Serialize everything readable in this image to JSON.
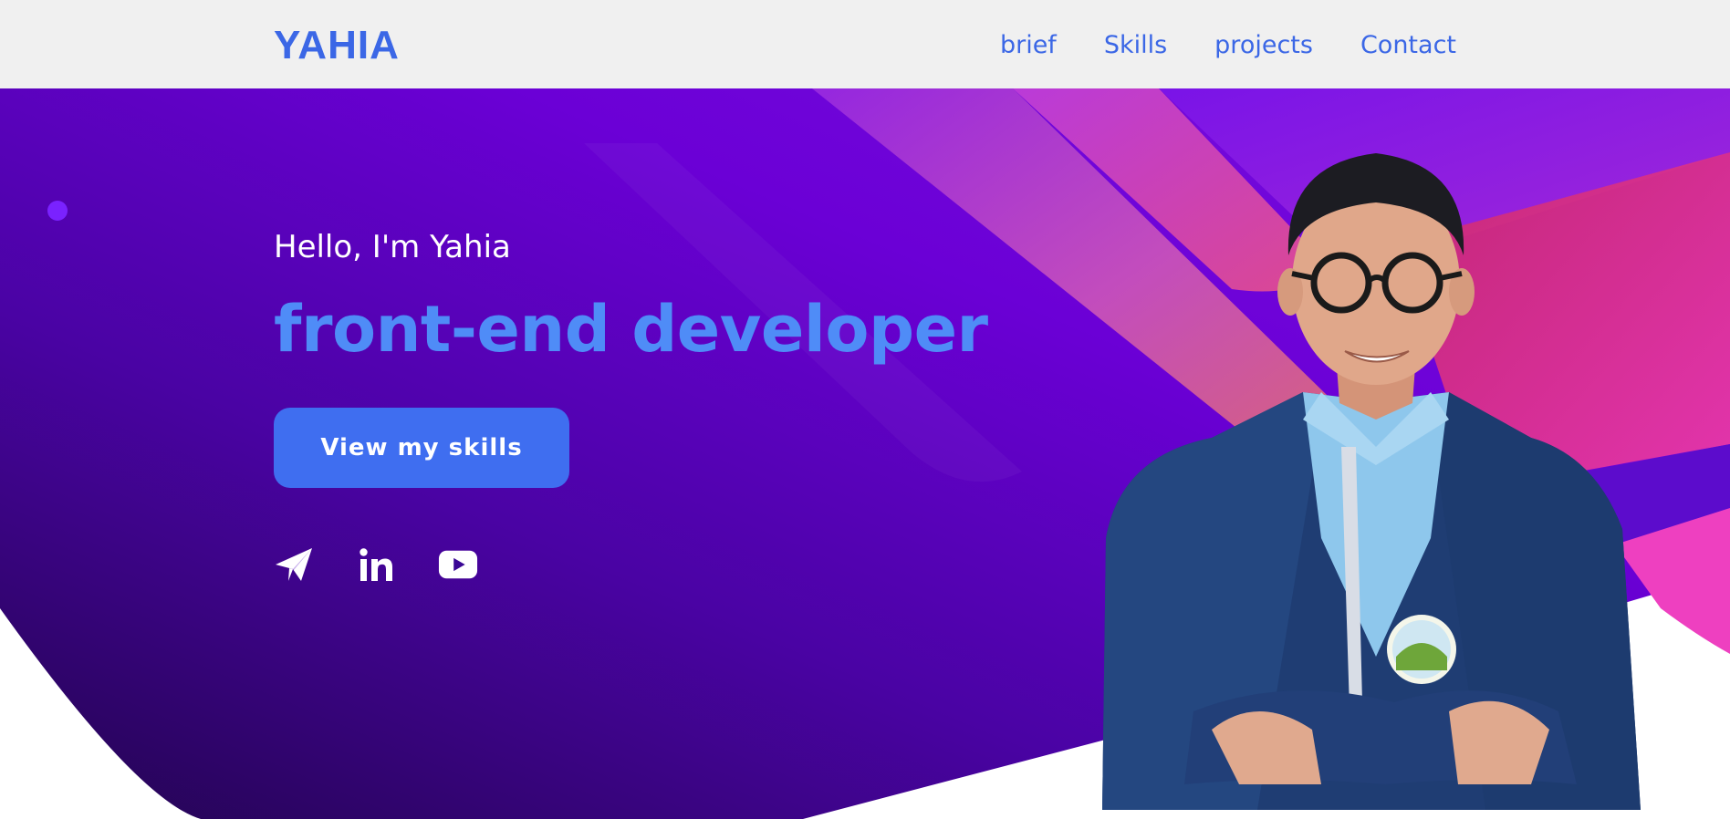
{
  "header": {
    "logo": "YAHIA",
    "nav": {
      "brief": "brief",
      "skills": "Skills",
      "projects": "projects",
      "contact": "Contact"
    }
  },
  "hero": {
    "greeting": "Hello, I'm Yahia",
    "headline": "front-end developer",
    "cta_label": "View my skills",
    "socials": [
      "telegram-icon",
      "linkedin-icon",
      "youtube-icon"
    ]
  },
  "colors": {
    "accent": "#3b67e6",
    "headline": "#4f8cf7",
    "button": "#3f6ef0",
    "hero_dark": "#2a0a6e",
    "hero_mid": "#5a07c4",
    "pink": "#e04fb8"
  }
}
